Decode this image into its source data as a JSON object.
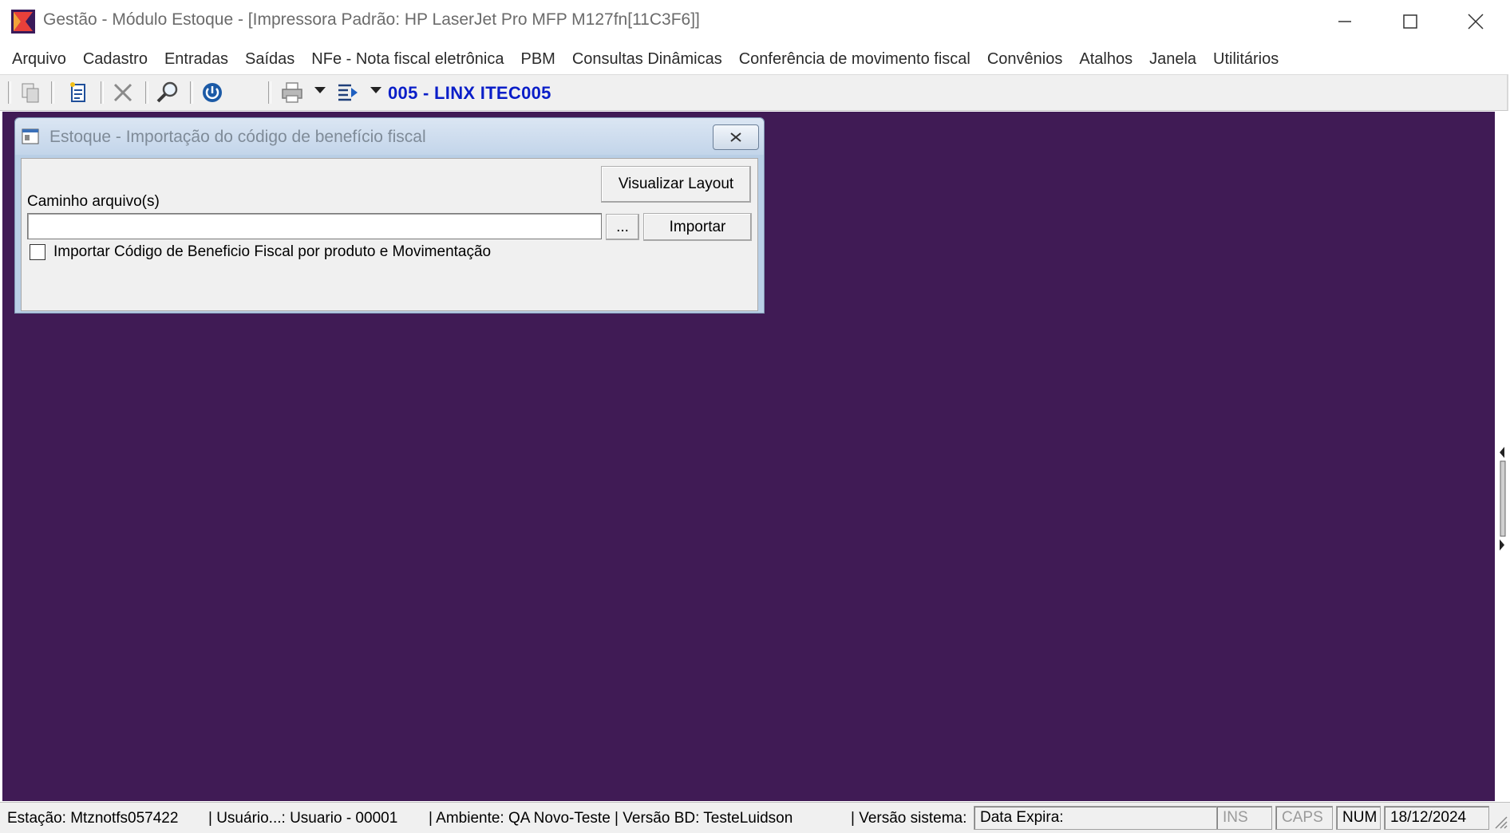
{
  "window": {
    "title": "Gestão  - Módulo Estoque - [Impressora Padrão: HP LaserJet Pro MFP M127fn[11C3F6]]"
  },
  "menu": {
    "items": [
      "Arquivo",
      "Cadastro",
      "Entradas",
      "Saídas",
      "NFe - Nota fiscal eletrônica",
      "PBM",
      "Consultas Dinâmicas",
      "Conferência de movimento fiscal",
      "Convênios",
      "Atalhos",
      "Janela",
      "Utilitários"
    ]
  },
  "toolbar": {
    "company": "005 - LINX ITEC005",
    "icons": [
      "copy-icon",
      "new-document-icon",
      "delete-icon",
      "search-icon",
      "power-icon",
      "print-icon",
      "list-icon"
    ]
  },
  "dialog": {
    "title": "Estoque - Importação do código de benefício fiscal",
    "view_layout_label": "Visualizar Layout",
    "path_label": "Caminho arquivo(s)",
    "path_value": "",
    "browse_label": "...",
    "import_label": "Importar",
    "checkbox_label": "Importar Código de Beneficio Fiscal por produto e Movimentação",
    "checkbox_checked": false
  },
  "statusbar": {
    "estacao": "Estação: Mtznotfs057422",
    "usuario": "| Usuário...: Usuario - 00001",
    "ambiente": "| Ambiente: QA Novo-Teste | Versão BD: TesteLuidson",
    "versao_sistema": "| Versão sistema:",
    "data_expira": "Data Expira:",
    "ins": "INS",
    "caps": "CAPS",
    "num": "NUM",
    "date": "18/12/2024"
  },
  "colors": {
    "workspace": "#401b55",
    "company_text": "#0a1ec8"
  }
}
